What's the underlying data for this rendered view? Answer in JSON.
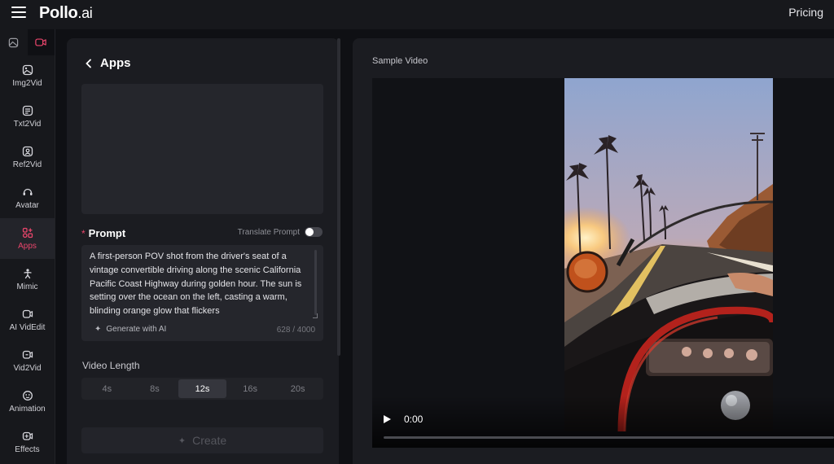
{
  "header": {
    "logo_main": "Pollo",
    "logo_suffix": ".ai",
    "pricing_label": "Pricing"
  },
  "rail": {
    "top_icons": [
      "image-icon",
      "video-icon"
    ],
    "items": [
      {
        "label": "Img2Vid",
        "icon": "image-to-video-icon",
        "active": false
      },
      {
        "label": "Txt2Vid",
        "icon": "text-to-video-icon",
        "active": false
      },
      {
        "label": "Ref2Vid",
        "icon": "reference-to-video-icon",
        "active": false
      },
      {
        "label": "Avatar",
        "icon": "avatar-icon",
        "active": false
      },
      {
        "label": "Apps",
        "icon": "apps-icon",
        "active": true
      },
      {
        "label": "Mimic",
        "icon": "mimic-icon",
        "active": false
      },
      {
        "label": "AI VidEdit",
        "icon": "video-edit-icon",
        "active": false
      },
      {
        "label": "Vid2Vid",
        "icon": "video-to-video-icon",
        "active": false
      },
      {
        "label": "Animation",
        "icon": "animation-icon",
        "active": false
      },
      {
        "label": "Effects",
        "icon": "effects-icon",
        "active": false
      }
    ]
  },
  "panel": {
    "back_label": "Apps",
    "prompt": {
      "label": "Prompt",
      "required_mark": "*",
      "translate_label": "Translate Prompt",
      "translate_on": false,
      "value": "A first-person POV shot from the driver's seat of a vintage convertible driving along the scenic California Pacific Coast Highway during golden hour. The sun is setting over the ocean on the left, casting a warm, blinding orange glow that flickers",
      "generate_label": "Generate with AI",
      "char_count": "628 / 4000"
    },
    "video_length": {
      "label": "Video Length",
      "options": [
        "4s",
        "8s",
        "12s",
        "16s",
        "20s"
      ],
      "selected": "12s"
    },
    "create_label": "Create"
  },
  "sample": {
    "label": "Sample Video",
    "time": "0:00",
    "progress": 0
  },
  "colors": {
    "accent": "#e8456b",
    "background": "#0f1014",
    "panel": "#1b1c21"
  }
}
